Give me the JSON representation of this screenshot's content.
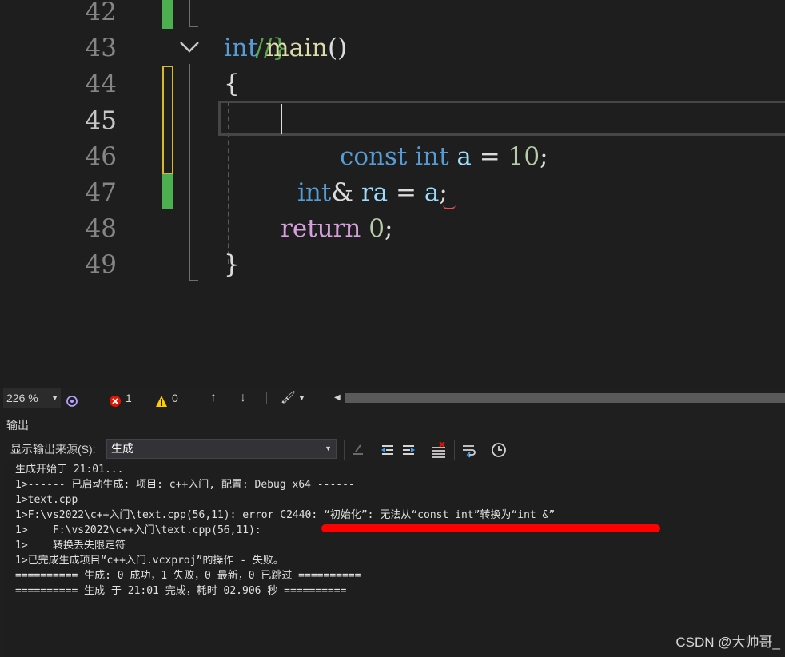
{
  "editor": {
    "line_numbers": [
      "42",
      "43",
      "44",
      "45",
      "46",
      "47",
      "48",
      "49"
    ],
    "current_line": "45",
    "code": {
      "l42_comment": "//}",
      "l43_kw": "int",
      "l43_fn": "main",
      "l43_paren": "()",
      "l44": "{",
      "l46_kw1": "const",
      "l46_kw2": "int",
      "l46_var": "a",
      "l46_eq": "=",
      "l46_num": "10",
      "l46_semi": ";",
      "l47_kw": "int",
      "l47_amp": "&",
      "l47_var": "ra",
      "l47_eq": "=",
      "l47_ref": "a",
      "l47_semi": ";",
      "l48_kw": "return",
      "l48_num": "0",
      "l48_semi": ";",
      "l49": "}"
    },
    "colors": {
      "keyword": "#569cd6",
      "control_keyword": "#d8a0df",
      "function": "#dcdcaa",
      "variable": "#9cdcfe",
      "number": "#b5cea8",
      "comment": "#57a64a",
      "saved_change": "#4caf50",
      "unsaved_change": "#d7ba28",
      "error_squiggle": "#f14c4c"
    }
  },
  "status_bar": {
    "zoom": "226 %",
    "error_count": "1",
    "warning_count": "0",
    "icons": [
      "intellicode-icon",
      "error-icon",
      "warning-icon",
      "arrow-up-icon",
      "arrow-down-icon",
      "brush-icon"
    ]
  },
  "output_panel": {
    "title": "输出",
    "source_label": "显示输出来源(S):",
    "source_value": "生成",
    "lines": [
      "生成开始于 21:01...",
      "1>------ 已启动生成: 项目: c++入门, 配置: Debug x64 ------",
      "1>text.cpp",
      "1>F:\\vs2022\\c++入门\\text.cpp(56,11): error C2440: “初始化”: 无法从“const int”转换为“int &”",
      "1>    F:\\vs2022\\c++入门\\text.cpp(56,11):",
      "1>    转换丢失限定符",
      "1>已完成生成项目“c++入门.vcxproj”的操作 - 失败。",
      "========== 生成: 0 成功，1 失败，0 最新，0 已跳过 ==========",
      "========== 生成 于 21:01 完成，耗时 02.906 秒 =========="
    ]
  },
  "watermark": "CSDN @大帅哥_"
}
